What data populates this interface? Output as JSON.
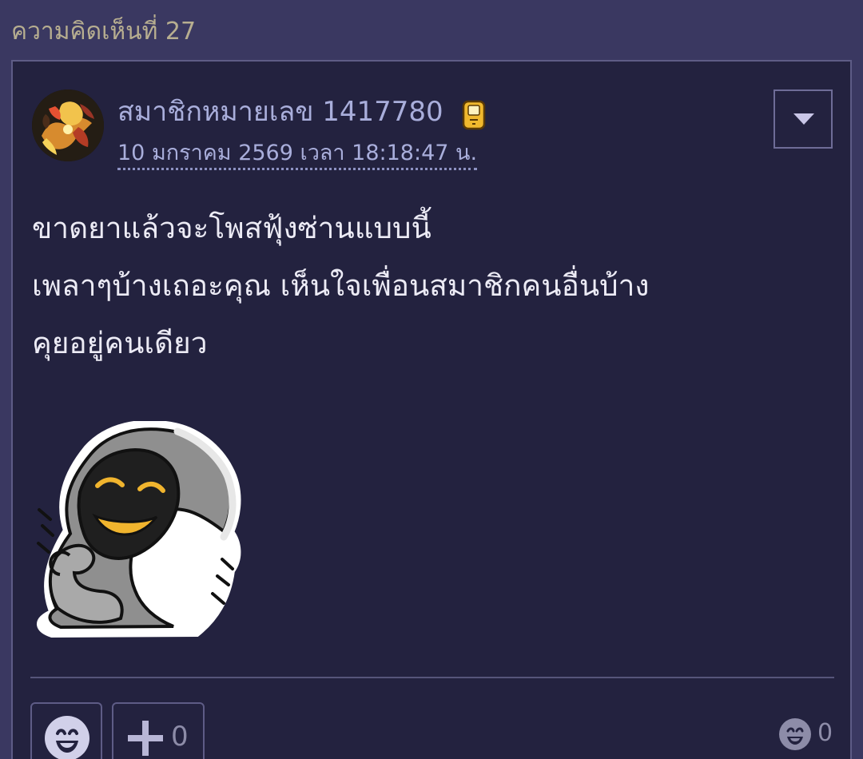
{
  "heading": {
    "title": "ความคิดเห็นที่ 27"
  },
  "comment": {
    "author": "สมาชิกหมายเลข 1417780",
    "author_badge_icon": "phone-badge-icon",
    "timestamp": "10 มกราคม 2569 เวลา 18:18:47 น.",
    "menu_icon": "caret-down-icon",
    "body_lines": [
      "ขาดยาแล้วจะโพสฟุ้งซ่านแบบนี้",
      "เพลาๆบ้างเถอะคุณ เห็นใจเพื่อนสมาชิกคนอื่นบ้าง",
      "คุยอยู่คนเดียว"
    ],
    "sticker_icon": "hooded-grin-sticker"
  },
  "actions": {
    "emotion_icon": "smile-icon",
    "vote_icon": "plus-icon",
    "vote_count": "0",
    "emotion_count": "0"
  },
  "colors": {
    "page_background": "#3a3861",
    "card_background": "#23223f",
    "heading_text": "#b7ae90",
    "meta_text": "#a9aedb",
    "body_text": "#ecebf5",
    "muted_text": "#8d8ca8"
  }
}
